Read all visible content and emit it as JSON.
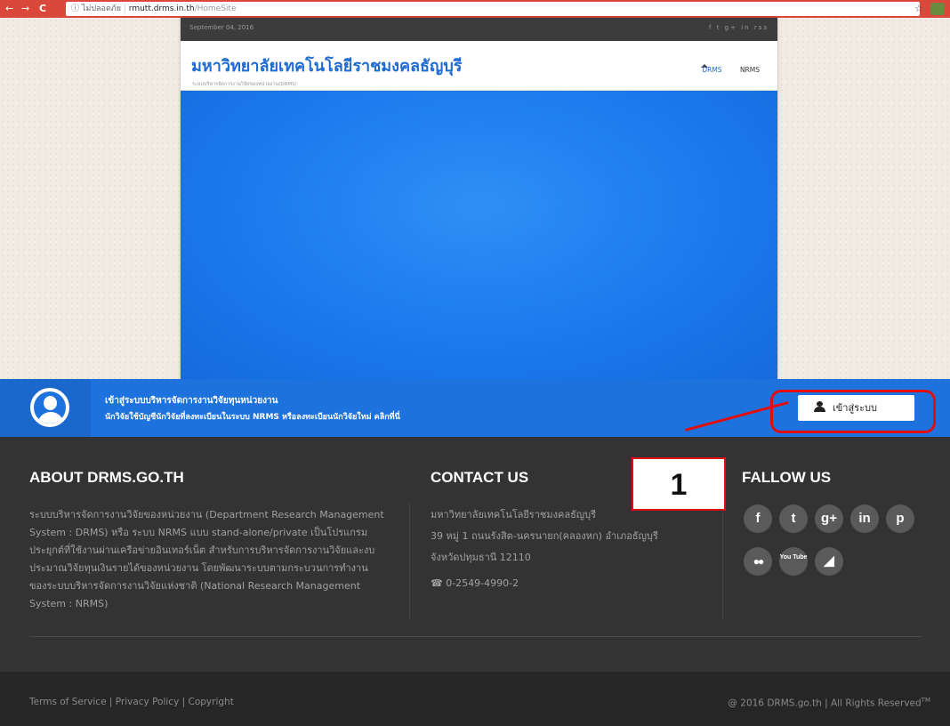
{
  "browser": {
    "back": "←",
    "forward": "→",
    "reload": "C",
    "info": "ⓘ ไม่ปลอดภัย",
    "host": "rmutt.drms.in.th",
    "path": "/HomeSite",
    "star": "☆"
  },
  "site": {
    "date": "September 04, 2016",
    "social_top": "f  t  g+  in  rss",
    "title": "มหาวิทยาลัยเทคโนโลยีราชมงคลธัญบุรี",
    "subtitle": "ระบบบริหารจัดการงานวิจัยของหน่วยงาน(DRMS)",
    "menu": [
      "DRMS",
      "NRMS"
    ]
  },
  "band": {
    "line1": "เข้าสู่ระบบบริหารจัดการงานวิจัยทุนหน่วยงาน",
    "line2": "นักวิจัยใช้บัญชีนักวิจัยที่ลงทะเบียนในระบบ NRMS หรือลงทะเบียนนักวิจัยใหม่ คลิกที่นี่",
    "login_label": "เข้าสู่ระบบ"
  },
  "callout": {
    "number": "1",
    "color": "#e10e0e"
  },
  "footer": {
    "about_title": "ABOUT DRMS.GO.TH",
    "about_text": "ระบบบริหารจัดการงานวิจัยของหน่วยงาน (Department Research Management System : DRMS) หรือ ระบบ NRMS แบบ stand-alone/private เป็นโปรแกรมประยุกต์ที่ใช้งานผ่านเครือข่ายอินเทอร์เน็ต สำหรับการบริหารจัดการงานวิจัยและงบประมาณวิจัยทุนเงินรายได้ของหน่วยงาน โดยพัฒนาระบบตามกระบวนการทำงานของระบบบริหารจัดการงานวิจัยแห่งชาติ (National Research Management System : NRMS)",
    "contact_title": "CONTACT US",
    "contact_lines": [
      "มหาวิทยาลัยเทคโนโลยีราชมงคลธัญบุรี",
      "39 หมู่ 1 ถนนรังสิต-นครนายก(คลองหก) อำเภอธัญบุรี",
      "จังหวัดปทุมธานี 12110"
    ],
    "phone": "☎ 0-2549-4990-2",
    "follow_title": "FALLOW US",
    "social_icons": [
      "f",
      "t",
      "g+",
      "in",
      "p",
      "flickr",
      "You Tube",
      "rss"
    ]
  },
  "bottom": {
    "links": "Terms of Service | Privacy Policy | Copyright",
    "copyright": "@ 2016 DRMS.go.th | All Rights Reserved",
    "tm": "TM"
  },
  "colors": {
    "chrome": "#d9483b",
    "brand_blue": "#1f6bd1",
    "band_blue": "#1e72dd",
    "footer_dark": "#333333",
    "highlight_red": "#e10e0e"
  }
}
